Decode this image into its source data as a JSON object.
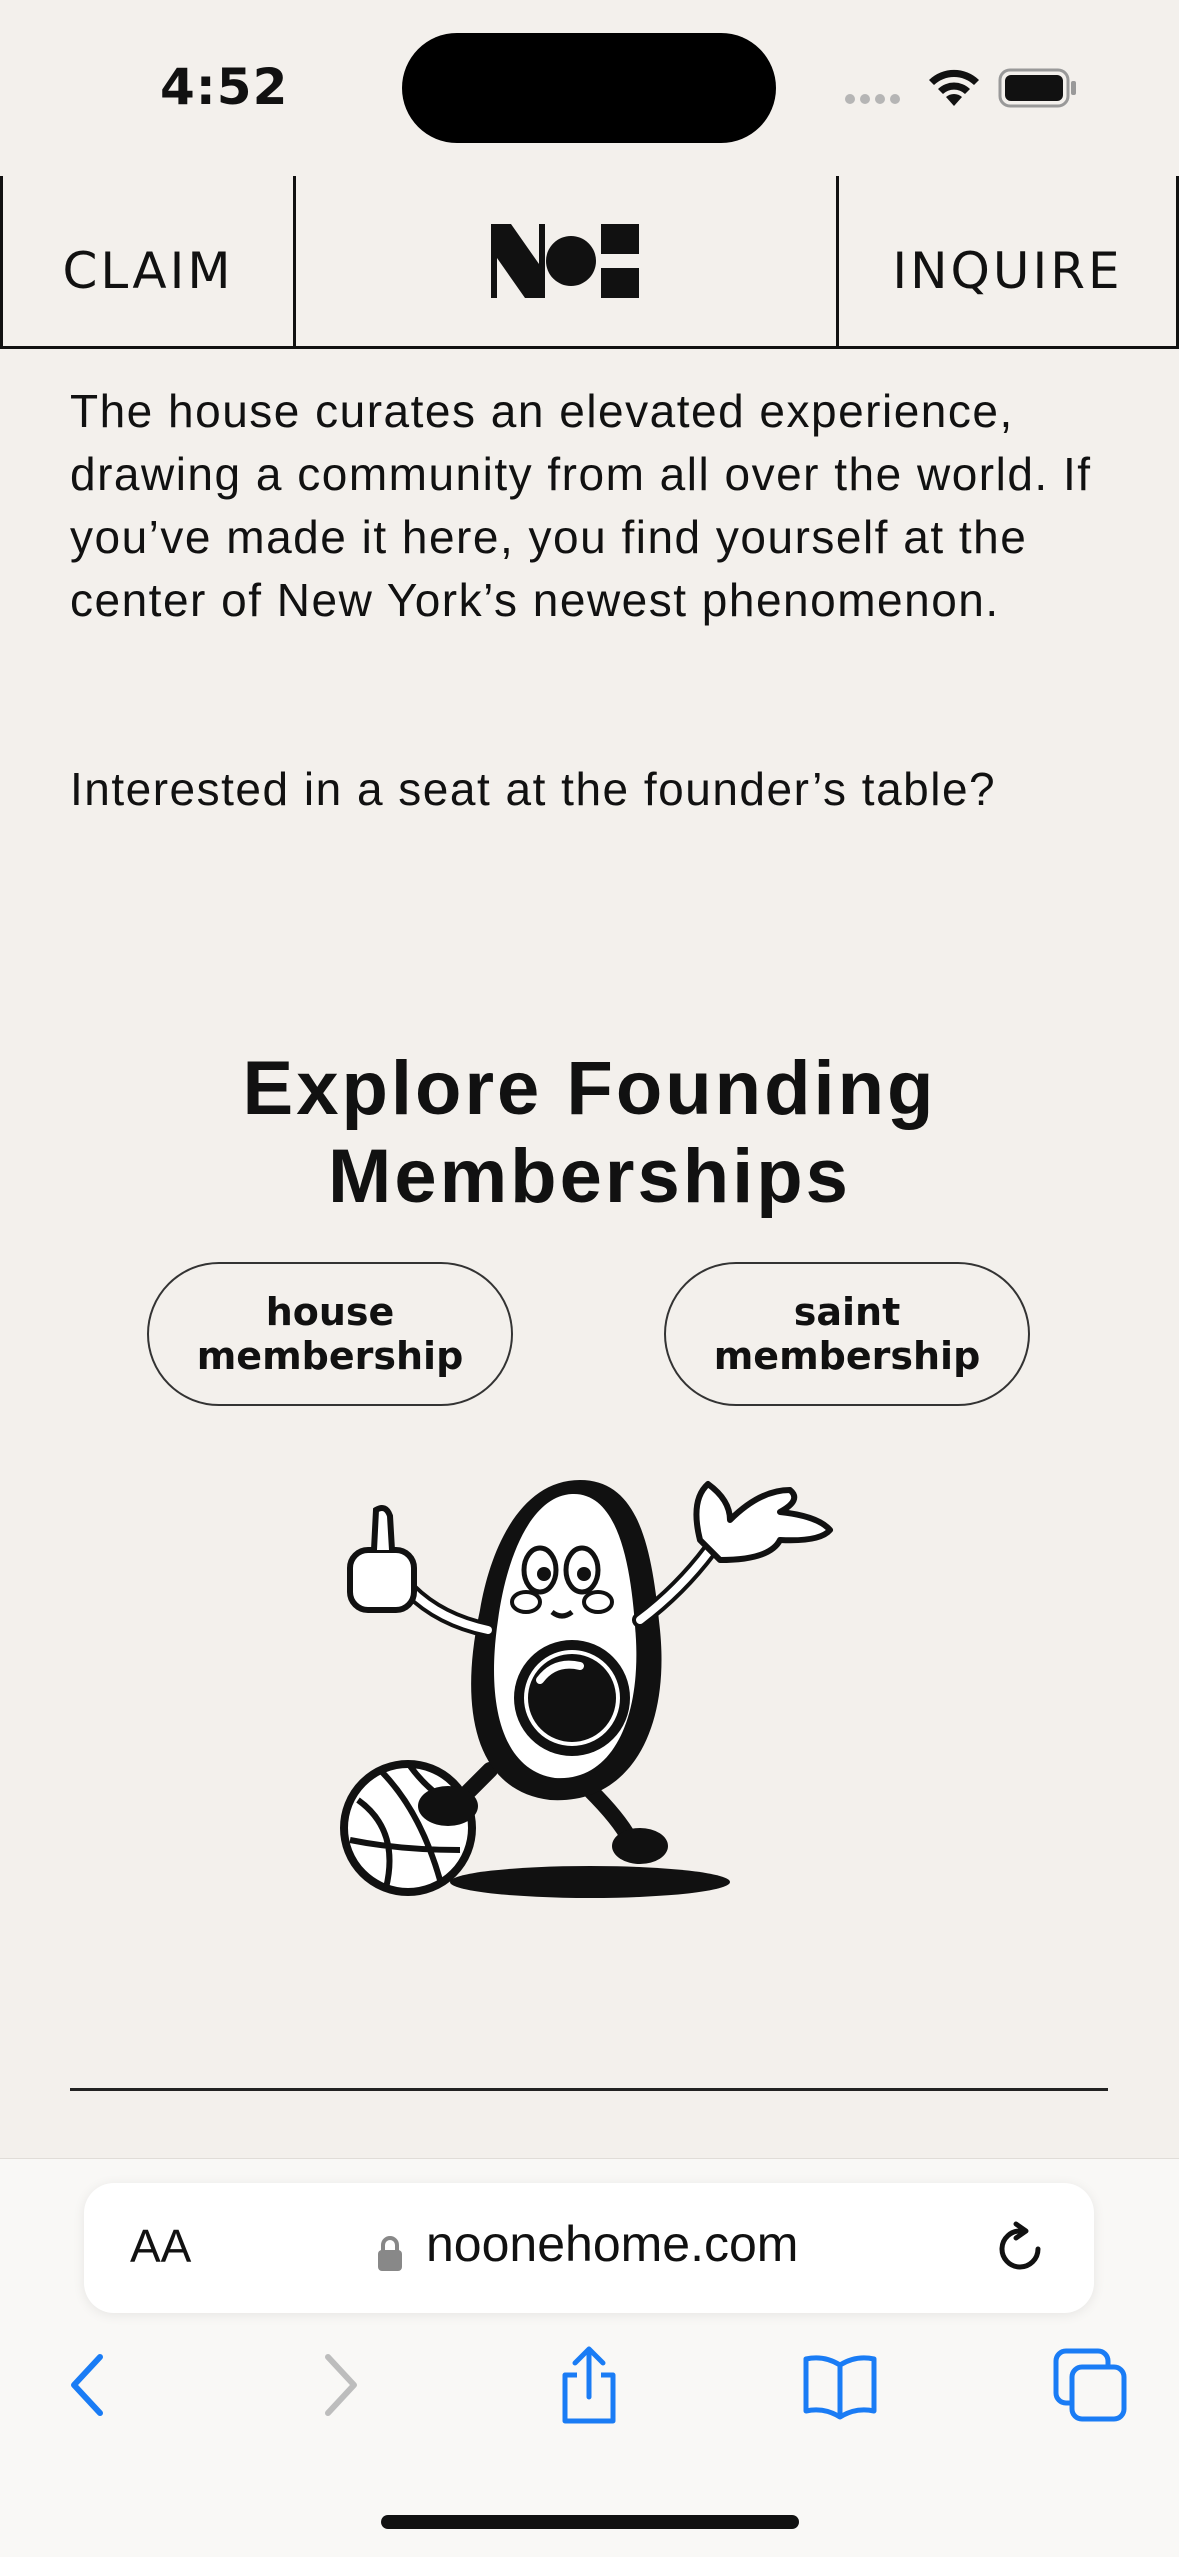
{
  "status_bar": {
    "time": "4:52"
  },
  "nav": {
    "claim_label": "CLAIM",
    "inquire_label": "INQUIRE",
    "logo_alt": "NoO"
  },
  "content": {
    "intro": "The house curates an elevated experience, drawing a community from all over the world. If you’ve made it here, you find yourself at the center of New York’s newest phenomenon.",
    "question": "Interested in a seat at the founder’s table?",
    "explore_title": "Explore Founding Memberships",
    "house_button": "house\nmembership",
    "saint_button": "saint\nmembership"
  },
  "browser": {
    "text_size_label": "AA",
    "url": "noonehome.com"
  },
  "colors": {
    "background": "#f3f0ec",
    "ink": "#111111",
    "ios_blue": "#1a7cf5"
  }
}
